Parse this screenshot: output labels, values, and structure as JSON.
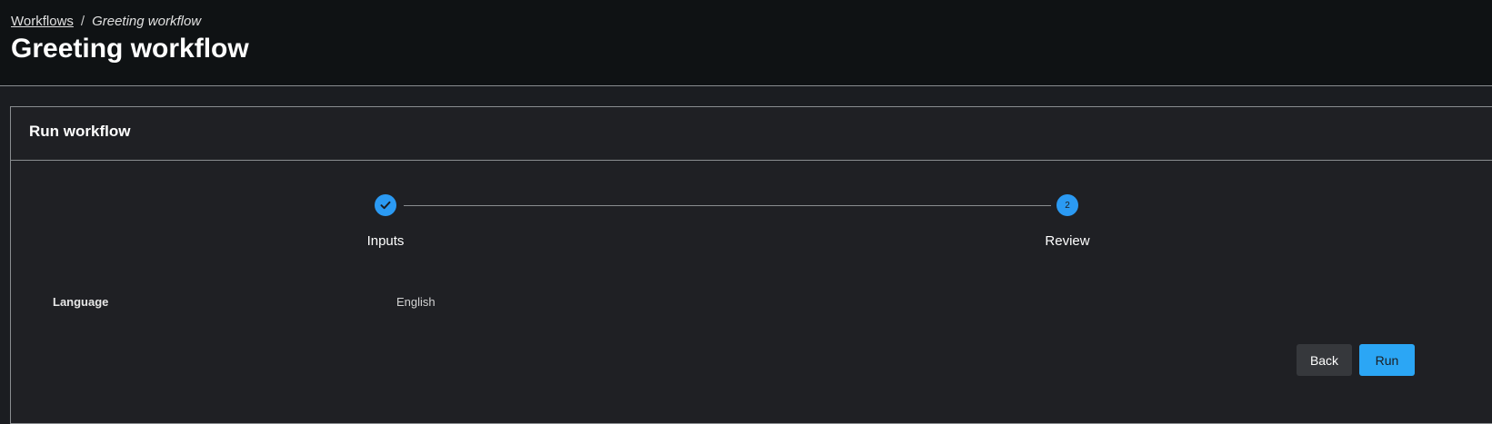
{
  "breadcrumb": {
    "parent": "Workflows",
    "separator": "/",
    "current": "Greeting workflow"
  },
  "page": {
    "title": "Greeting workflow"
  },
  "card": {
    "title": "Run workflow"
  },
  "stepper": {
    "steps": [
      {
        "label": "Inputs",
        "state": "completed",
        "icon": "check-icon"
      },
      {
        "label": "Review",
        "state": "current",
        "number": "2"
      }
    ]
  },
  "review": {
    "rows": [
      {
        "key": "Language",
        "value": "English"
      }
    ]
  },
  "actions": {
    "back_label": "Back",
    "run_label": "Run"
  },
  "colors": {
    "accent": "#2b9af3",
    "header_bg": "#0f1214",
    "card_bg": "#1f2024"
  }
}
